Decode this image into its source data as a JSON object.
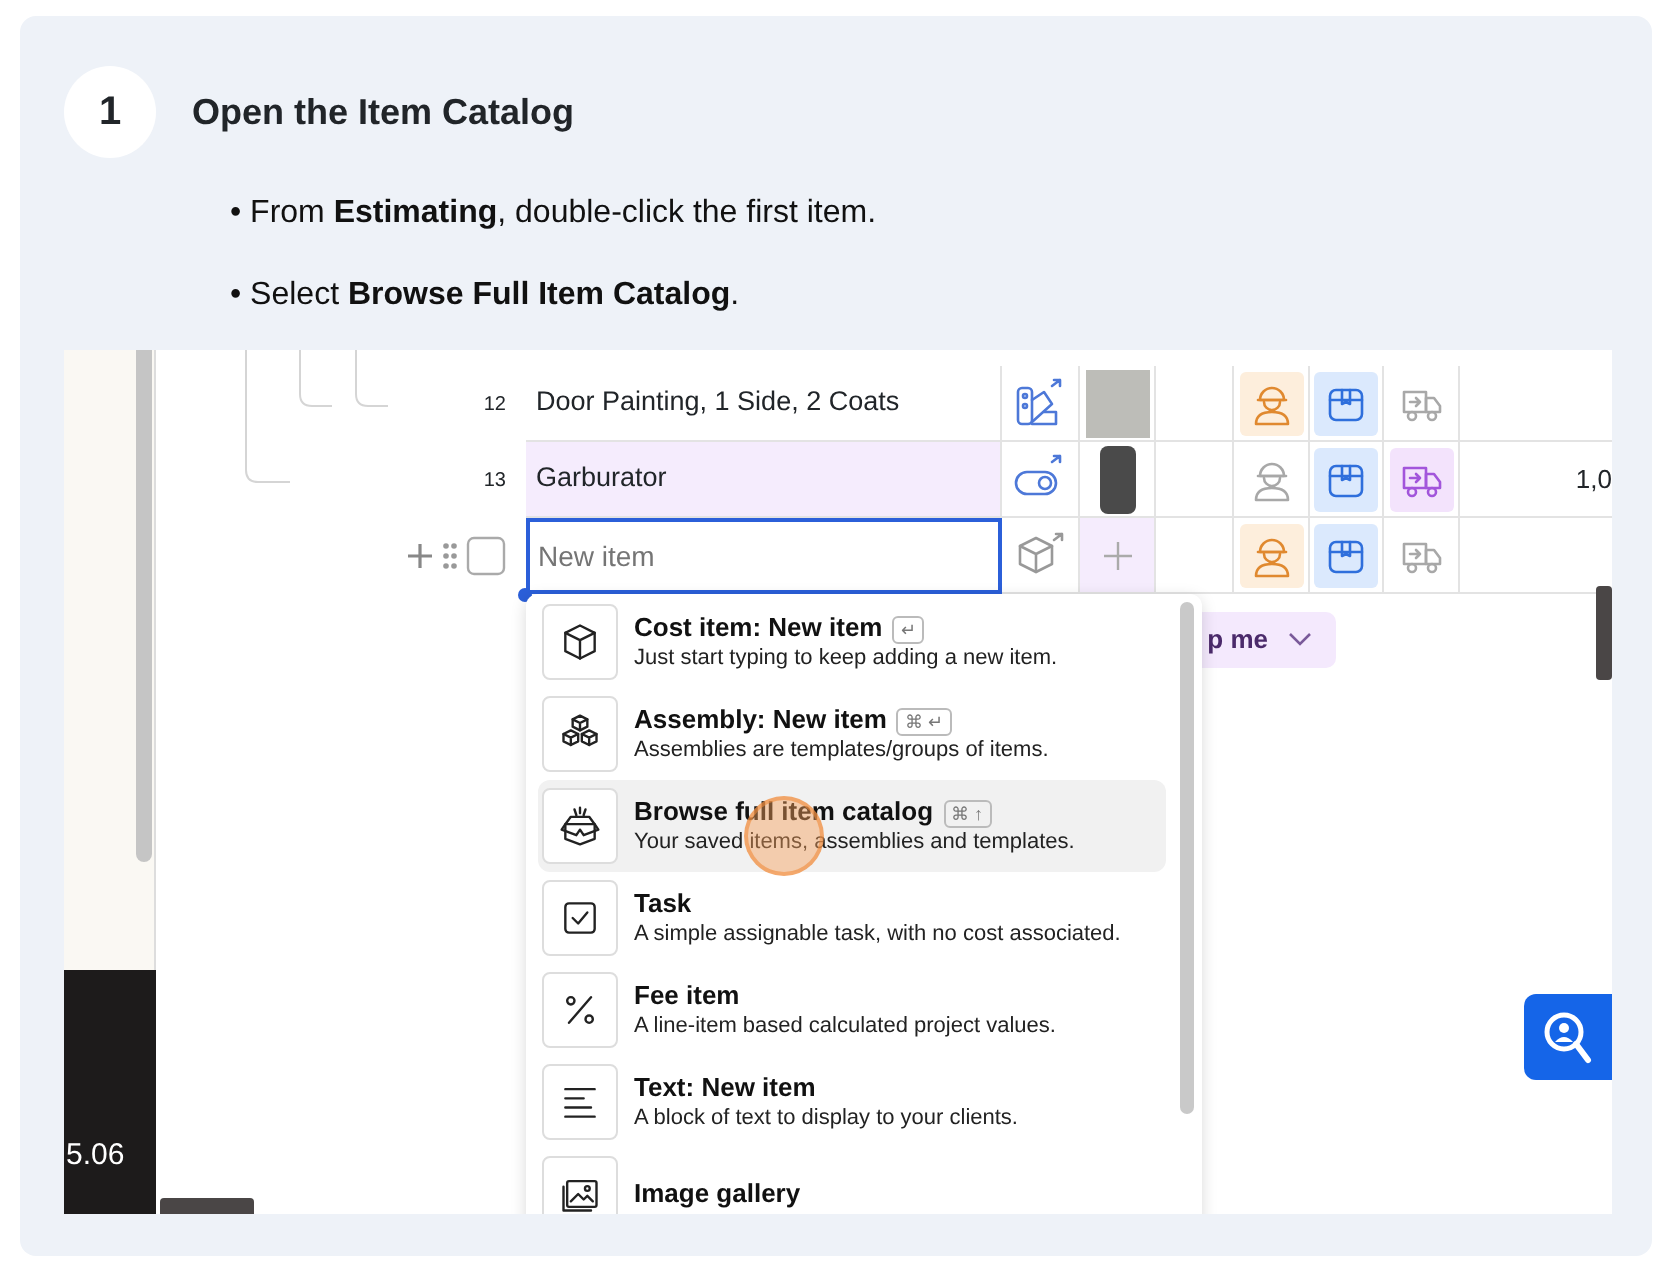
{
  "step": {
    "number": "1",
    "title": "Open the Item Catalog"
  },
  "instructions": [
    {
      "text": "• From **Estimating**, double-click the first item."
    },
    {
      "text": "• Select **Browse Full Item Catalog**."
    }
  ],
  "screenshot": {
    "sidebar_value": "5.06",
    "rows": [
      {
        "number": "12",
        "name": "Door Painting, 1 Side, 2 Coats",
        "labor": true,
        "materials": true,
        "delivery": false,
        "highlighted": false,
        "amount": ""
      },
      {
        "number": "13",
        "name": "Garburator",
        "labor": false,
        "materials": true,
        "delivery": true,
        "highlighted": true,
        "amount": "1,0"
      }
    ],
    "new_item": {
      "placeholder": "New item",
      "checked": false,
      "labor": true,
      "materials": true,
      "delivery": false
    },
    "chip": {
      "label": "p me"
    },
    "menu": [
      {
        "title": "Cost item: New item",
        "shortcut": "↵",
        "description": "Just start typing to keep adding a new item.",
        "selected": false
      },
      {
        "title": "Assembly: New item",
        "shortcut": "⌘ ↵",
        "description": "Assemblies are templates/groups of items.",
        "selected": false
      },
      {
        "title": "Browse full item catalog",
        "shortcut": "⌘ ↑",
        "description": "Your saved items, assemblies and templates.",
        "selected": true
      },
      {
        "title": "Task",
        "description": "A simple assignable task, with no cost associated.",
        "selected": false
      },
      {
        "title": "Fee item",
        "description": "A line-item based calculated project values.",
        "selected": false
      },
      {
        "title": "Text: New item",
        "description": "A block of text to display to your clients.",
        "selected": false
      },
      {
        "title": "Image gallery",
        "selected": false
      }
    ]
  }
}
